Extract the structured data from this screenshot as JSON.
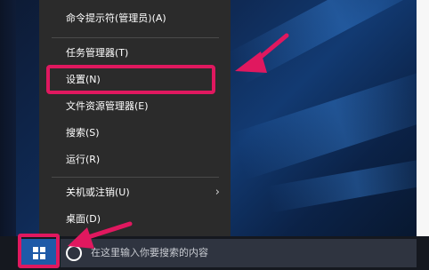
{
  "start_menu": {
    "items": [
      {
        "label": "命令提示符(管理员)(A)",
        "has_submenu": false
      },
      {
        "label": "任务管理器(T)",
        "has_submenu": false
      },
      {
        "label": "设置(N)",
        "has_submenu": false,
        "highlighted": true
      },
      {
        "label": "文件资源管理器(E)",
        "has_submenu": false
      },
      {
        "label": "搜索(S)",
        "has_submenu": false
      },
      {
        "label": "运行(R)",
        "has_submenu": false
      },
      {
        "label": "关机或注销(U)",
        "has_submenu": true
      },
      {
        "label": "桌面(D)",
        "has_submenu": false
      }
    ]
  },
  "taskbar": {
    "search_placeholder": "在这里输入你要搜索的内容"
  },
  "icons": {
    "start": "windows-logo-icon",
    "search": "cortana-circle-icon",
    "submenu": "chevron-right-icon",
    "annotation": "pink-arrow-icon"
  },
  "colors": {
    "menu_bg": "#2b2b2b",
    "annotation": "#e0185f",
    "start_button": "#1f5aa8"
  }
}
